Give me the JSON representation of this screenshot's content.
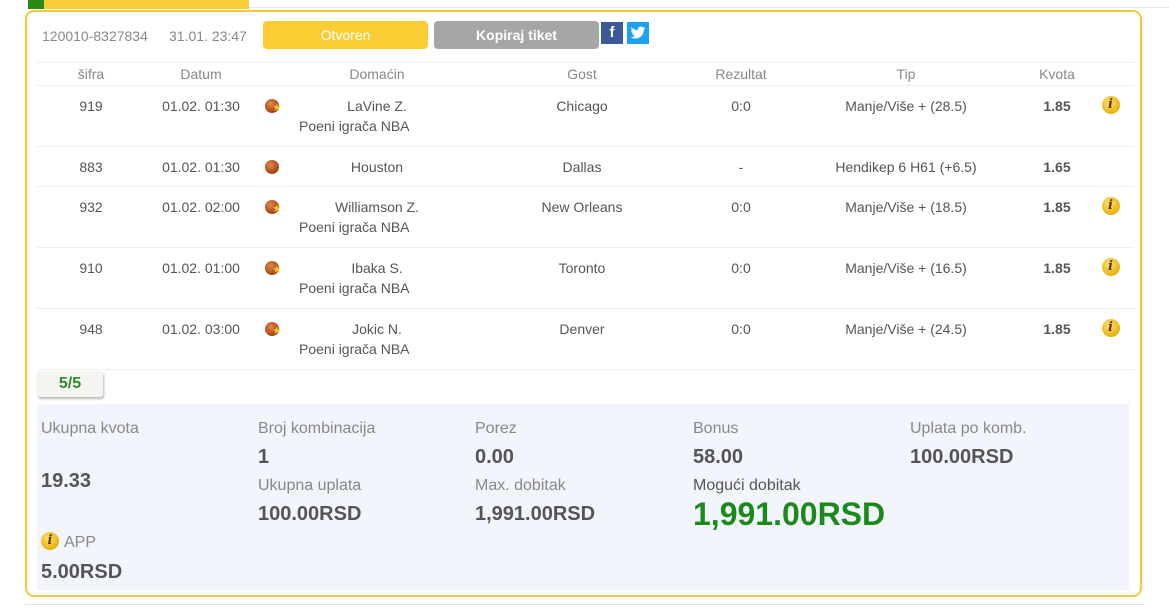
{
  "ticket": {
    "id": "120010-8327834",
    "datetime": "31.01. 23:47",
    "status_label": "Otvoren",
    "copy_label": "Kopiraj tiket",
    "facebook_glyph": "f",
    "twitter_glyph": "🐦"
  },
  "columns": [
    "šifra",
    "Datum",
    "Domaćin",
    "Gost",
    "Rezultat",
    "Tip",
    "Kvota"
  ],
  "bets": [
    {
      "code": "919",
      "date": "01.02. 01:30",
      "home": "LaVine Z.",
      "away": "Chicago",
      "result": "0:0",
      "tip": "Manje/Više + (28.5)",
      "odds": "1.85",
      "sub": "Poeni igrača NBA",
      "icon": "basketball-star-icon",
      "info": true
    },
    {
      "code": "883",
      "date": "01.02. 01:30",
      "home": "Houston",
      "away": "Dallas",
      "result": "-",
      "tip": "Hendikep 6 H61 (+6.5)",
      "odds": "1.65",
      "sub": "",
      "icon": "basketball-icon",
      "info": false
    },
    {
      "code": "932",
      "date": "01.02. 02:00",
      "home": "Williamson Z.",
      "away": "New Orleans",
      "result": "0:0",
      "tip": "Manje/Više + (18.5)",
      "odds": "1.85",
      "sub": "Poeni igrača NBA",
      "icon": "basketball-star-icon",
      "info": true
    },
    {
      "code": "910",
      "date": "01.02. 01:00",
      "home": "Ibaka S.",
      "away": "Toronto",
      "result": "0:0",
      "tip": "Manje/Više + (16.5)",
      "odds": "1.85",
      "sub": "Poeni igrača NBA",
      "icon": "basketball-star-icon",
      "info": true
    },
    {
      "code": "948",
      "date": "01.02. 03:00",
      "home": "Jokic N.",
      "away": "Denver",
      "result": "0:0",
      "tip": "Manje/Više + (24.5)",
      "odds": "1.85",
      "sub": "Poeni igrača NBA",
      "icon": "basketball-star-icon",
      "info": true
    }
  ],
  "count": "5/5",
  "summary": {
    "total_odds_label": "Ukupna kvota",
    "total_odds": "19.33",
    "combinations_label": "Broj kombinacija",
    "combinations": "1",
    "tax_label": "Porez",
    "tax": "0.00",
    "bonus_label": "Bonus",
    "bonus": "58.00",
    "stake_per_comb_label": "Uplata po komb.",
    "stake_per_comb": "100.00RSD",
    "total_stake_label": "Ukupna uplata",
    "total_stake": "100.00RSD",
    "max_win_label": "Max. dobitak",
    "max_win": "1,991.00RSD",
    "possible_win_label": "Mogući dobitak",
    "possible_win": "1,991.00RSD",
    "app_label": "APP",
    "app_value": "5.00RSD",
    "info_glyph": "i"
  },
  "colors": {
    "accent_yellow": "#f9cd33",
    "win_green": "#1b8a1b",
    "copy_gray": "#a6a6a6",
    "border_yellow": "#f3c93a"
  }
}
